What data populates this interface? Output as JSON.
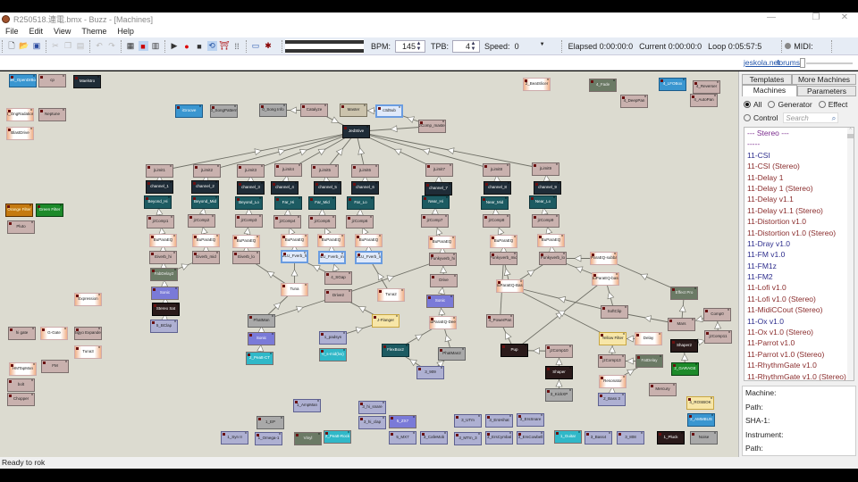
{
  "window": {
    "title": "R250518.連電.bmx - Buzz - [Machines]",
    "minimize": "—",
    "restore": "❐",
    "close": "✕"
  },
  "menu": [
    "File",
    "Edit",
    "View",
    "Theme",
    "Help"
  ],
  "toolbar": {
    "bpm_label": "BPM:",
    "bpm_value": "145",
    "tpb_label": "TPB:",
    "tpb_value": "4",
    "speed_label": "Speed:",
    "speed_value": "0",
    "elapsed": "Elapsed 0:00:00:0",
    "current": "Current 0:00:00:0",
    "loop": "Loop 0:05:57:5",
    "midi_label": "MIDI:"
  },
  "links": {
    "site": "jeskola.net",
    "forums": "forums"
  },
  "machines": [
    {
      "id": "sell",
      "name": "Sell_OpenDrBox"
    },
    {
      "id": "cp",
      "name": "cp"
    },
    {
      "id": "mael",
      "name": "Maelstro"
    },
    {
      "id": "ong",
      "name": "4_OngRadation"
    },
    {
      "id": "nep",
      "name": "Neptune"
    },
    {
      "id": "blast",
      "name": "BlastDrive"
    },
    {
      "id": "igr",
      "name": "iGroove"
    },
    {
      "id": "spat",
      "name": "0_SongPattern"
    },
    {
      "id": "sinfo",
      "name": "0_Song Info"
    },
    {
      "id": "cat",
      "name": "Catalyze"
    },
    {
      "id": "master",
      "name": "Master"
    },
    {
      "id": "sub",
      "name": "c3d5ub"
    },
    {
      "id": "jed",
      "name": "JedStive"
    },
    {
      "id": "jzm",
      "name": "jzComp_master"
    },
    {
      "id": "jl1",
      "name": "jLimit1"
    },
    {
      "id": "jl2",
      "name": "jLimit2"
    },
    {
      "id": "jl3",
      "name": "jLimit3"
    },
    {
      "id": "jl4",
      "name": "jLimit4"
    },
    {
      "id": "jl5",
      "name": "jLimit5"
    },
    {
      "id": "jl6",
      "name": "jLimit6"
    },
    {
      "id": "jl7",
      "name": "jLimit7"
    },
    {
      "id": "jl8",
      "name": "jLimit8"
    },
    {
      "id": "jl9",
      "name": "jLimit9"
    },
    {
      "id": "ch1",
      "name": "channel_1"
    },
    {
      "id": "ch2",
      "name": "channel_2"
    },
    {
      "id": "ch3",
      "name": "channel_3"
    },
    {
      "id": "ch4",
      "name": "channel_4"
    },
    {
      "id": "ch5",
      "name": "channel_5"
    },
    {
      "id": "ch6",
      "name": "channel_6"
    },
    {
      "id": "ch7",
      "name": "channel_7"
    },
    {
      "id": "ch8",
      "name": "channel_8"
    },
    {
      "id": "ch9",
      "name": "channel_9"
    },
    {
      "id": "bh",
      "name": "Beyond_Hi"
    },
    {
      "id": "bm",
      "name": "Beyond_Mid"
    },
    {
      "id": "bl",
      "name": "Beyond_Lo"
    },
    {
      "id": "fh",
      "name": "Far_Hi"
    },
    {
      "id": "fm",
      "name": "Far_Mid"
    },
    {
      "id": "fl",
      "name": "Far_Lo"
    },
    {
      "id": "nh",
      "name": "Near_Hi"
    },
    {
      "id": "nm",
      "name": "Near_Mid"
    },
    {
      "id": "nl",
      "name": "Near_Lo"
    },
    {
      "id": "jc1",
      "name": "jzComp1"
    },
    {
      "id": "jc2",
      "name": "jzComp2"
    },
    {
      "id": "jc3",
      "name": "jzComp3"
    },
    {
      "id": "jc4",
      "name": "jzComp4"
    },
    {
      "id": "jc5",
      "name": "jzComp5"
    },
    {
      "id": "jc6",
      "name": "jzComp6"
    },
    {
      "id": "jc7",
      "name": "jzComp7"
    },
    {
      "id": "jc8",
      "name": "jzComp8"
    },
    {
      "id": "jc9",
      "name": "jzComp9"
    },
    {
      "id": "eq1",
      "name": "BuParaEQ"
    },
    {
      "id": "eq2",
      "name": "BuParaEQ"
    },
    {
      "id": "eq3",
      "name": "BuParaEQ"
    },
    {
      "id": "eq4",
      "name": "BuParaEQ"
    },
    {
      "id": "eq5",
      "name": "BuParaEQ"
    },
    {
      "id": "eq6",
      "name": "BuParaEQ"
    },
    {
      "id": "eq7",
      "name": "BuParaEQ"
    },
    {
      "id": "eq8",
      "name": "BuParaEQ"
    },
    {
      "id": "eq9",
      "name": "BuParaEQ"
    },
    {
      "id": "evh",
      "name": "Eiverb_hi"
    },
    {
      "id": "evm",
      "name": "Eiverb_mid"
    },
    {
      "id": "evl",
      "name": "Eiverb_lo"
    },
    {
      "id": "mh",
      "name": "MLU_Fverb_hi"
    },
    {
      "id": "mm",
      "name": "MLU_Fverb_mid"
    },
    {
      "id": "ml",
      "name": "MLU_Fverb_lo"
    },
    {
      "id": "fkh",
      "name": "Funkyverb_hi"
    },
    {
      "id": "fkm",
      "name": "Funkyverb_mid"
    },
    {
      "id": "fkl",
      "name": "Funkyverb_lo"
    },
    {
      "id": "eqsb",
      "name": "BuParaEQ-subbass"
    },
    {
      "id": "fab",
      "name": "FabDelay2"
    },
    {
      "id": "son1",
      "name": "Sonic"
    },
    {
      "id": "ssat",
      "name": "Stereo Sat"
    },
    {
      "id": "bclap",
      "name": "5_BClap"
    },
    {
      "id": "expr",
      "name": "Expression"
    },
    {
      "id": "hig",
      "name": "hi gate"
    },
    {
      "id": "gg",
      "name": "G-Gate"
    },
    {
      "id": "bigyo",
      "name": "Bigyo Expander"
    },
    {
      "id": "tuna3",
      "name": "Tuna3"
    },
    {
      "id": "hmt",
      "name": "HMTapMan"
    },
    {
      "id": "fmm",
      "name": "FM"
    },
    {
      "id": "bolt",
      "name": "bolt"
    },
    {
      "id": "chop",
      "name": "Chopper"
    },
    {
      "id": "orf",
      "name": "Orange Filter"
    },
    {
      "id": "grf",
      "name": "Green Filter"
    },
    {
      "id": "pluto",
      "name": "Pluto"
    },
    {
      "id": "sgap",
      "name": "4_SGap"
    },
    {
      "id": "tuna",
      "name": "Tuna"
    },
    {
      "id": "drive2",
      "name": "Drive2"
    },
    {
      "id": "tuna2",
      "name": "Tuna2"
    },
    {
      "id": "drive",
      "name": "Drive"
    },
    {
      "id": "son3",
      "name": "Sonic"
    },
    {
      "id": "eqdeep",
      "name": "BuParaEQ-Deep"
    },
    {
      "id": "phat",
      "name": "PhatMan"
    },
    {
      "id": "son2",
      "name": "Sonic"
    },
    {
      "id": "peatt",
      "name": "2_Peatt-CT"
    },
    {
      "id": "jfl",
      "name": "J-Flanger"
    },
    {
      "id": "pad",
      "name": "1_padsyn"
    },
    {
      "id": "smid",
      "name": "0_s-mid(lvx)"
    },
    {
      "id": "flex",
      "name": "FlexBox2"
    },
    {
      "id": "phat2",
      "name": "PhatMan2"
    },
    {
      "id": "909",
      "name": "3_909"
    },
    {
      "id": "bs",
      "name": "2_BeatSlicer"
    },
    {
      "id": "fade",
      "name": "4_Fade"
    },
    {
      "id": "dpan",
      "name": "4_DeepPan"
    },
    {
      "id": "lfo",
      "name": "4_LFOBox"
    },
    {
      "id": "rev",
      "name": "4_Reverser"
    },
    {
      "id": "apan",
      "name": "4_AutoPan"
    },
    {
      "id": "eqb",
      "name": "BuParaEQ-Bass"
    },
    {
      "id": "eqb2",
      "name": "BuParaEQ-bass"
    },
    {
      "id": "soft",
      "name": "SoftClip"
    },
    {
      "id": "efx",
      "name": "Effect Pro"
    },
    {
      "id": "mars",
      "name": "Mars"
    },
    {
      "id": "comp0",
      "name": "Comp0"
    },
    {
      "id": "jc11",
      "name": "jzComp11"
    },
    {
      "id": "ppan",
      "name": "4_PowerPan"
    },
    {
      "id": "dog",
      "name": "Pup"
    },
    {
      "id": "jc10",
      "name": "jzComp10"
    },
    {
      "id": "shaper",
      "name": "Shaper"
    },
    {
      "id": "kick",
      "name": "3_KickXP"
    },
    {
      "id": "yf",
      "name": "Yellow Filter"
    },
    {
      "id": "delay",
      "name": "Delay"
    },
    {
      "id": "jc13",
      "name": "jzComp13"
    },
    {
      "id": "fatd",
      "name": "FatDelay"
    },
    {
      "id": "reso",
      "name": "Resonator"
    },
    {
      "id": "bass3",
      "name": "2_Bass 3"
    },
    {
      "id": "shaper2",
      "name": "Shaper2"
    },
    {
      "id": "garage",
      "name": "2_GARAGE"
    },
    {
      "id": "merc",
      "name": "Mercury"
    },
    {
      "id": "rosbok",
      "name": "4_ROSBOK"
    },
    {
      "id": "amm",
      "name": "2_AMMBUS"
    },
    {
      "id": "amp",
      "name": "1_AmpMan"
    },
    {
      "id": "hsn",
      "name": "3_hi_snare"
    },
    {
      "id": "hcl",
      "name": "3_hi_clap"
    },
    {
      "id": "zx7",
      "name": "5_ZX7"
    },
    {
      "id": "ep",
      "name": "1_EP"
    },
    {
      "id": "syn2",
      "name": "1_Syn II"
    },
    {
      "id": "omega",
      "name": "1_Omega-1"
    },
    {
      "id": "vinyl",
      "name": "Vinyl"
    },
    {
      "id": "prock",
      "name": "2_Peatt-Rock"
    },
    {
      "id": "mx7",
      "name": "5_MX7"
    },
    {
      "id": "cafe",
      "name": "3_CafeMob"
    },
    {
      "id": "utm",
      "name": "3_UTm"
    },
    {
      "id": "mtm",
      "name": "3_MTm_3"
    },
    {
      "id": "ehh",
      "name": "3_ErsHihat"
    },
    {
      "id": "esn",
      "name": "3_ErsSnare"
    },
    {
      "id": "ecy",
      "name": "3_ErsCymbal"
    },
    {
      "id": "ecb",
      "name": "3_ErsCowbell"
    },
    {
      "id": "guit",
      "name": "1_Guitar"
    },
    {
      "id": "bass4",
      "name": "3_Bass4"
    },
    {
      "id": "808",
      "name": "3_808"
    },
    {
      "id": "pluck",
      "name": "1_Pluck"
    },
    {
      "id": "noise",
      "name": "Noise"
    }
  ],
  "connections": [
    [
      "jl1",
      "jed"
    ],
    [
      "jl2",
      "jed"
    ],
    [
      "jl3",
      "jed"
    ],
    [
      "jl4",
      "jed"
    ],
    [
      "jl5",
      "jed"
    ],
    [
      "jl6",
      "jed"
    ],
    [
      "jl7",
      "jed"
    ],
    [
      "jl8",
      "jed"
    ],
    [
      "jl9",
      "jed"
    ],
    [
      "cat",
      "sinfo"
    ],
    [
      "cat",
      "jed"
    ],
    [
      "sub",
      "master"
    ],
    [
      "jzm",
      "jed"
    ],
    [
      "jzm",
      "sub"
    ],
    [
      "ch1",
      "jl1"
    ],
    [
      "ch2",
      "jl2"
    ],
    [
      "ch3",
      "jl3"
    ],
    [
      "ch4",
      "jl4"
    ],
    [
      "ch5",
      "jl5"
    ],
    [
      "ch6",
      "jl6"
    ],
    [
      "ch7",
      "jl7"
    ],
    [
      "ch8",
      "jl8"
    ],
    [
      "ch9",
      "jl9"
    ],
    [
      "jc1",
      "bh"
    ],
    [
      "jc2",
      "bm"
    ],
    [
      "jc3",
      "bl"
    ],
    [
      "jc4",
      "fh"
    ],
    [
      "jc5",
      "fm"
    ],
    [
      "jc6",
      "fl"
    ],
    [
      "jc7",
      "nh"
    ],
    [
      "jc8",
      "nm"
    ],
    [
      "jc9",
      "nl"
    ],
    [
      "eq1",
      "jc1"
    ],
    [
      "eq2",
      "jc2"
    ],
    [
      "eq3",
      "jc3"
    ],
    [
      "eq4",
      "jc4"
    ],
    [
      "eq5",
      "jc5"
    ],
    [
      "eq6",
      "jc6"
    ],
    [
      "eq7",
      "jc7"
    ],
    [
      "eq8",
      "jc8"
    ],
    [
      "eq9",
      "jc9"
    ],
    [
      "evh",
      "eq1"
    ],
    [
      "evm",
      "eq2"
    ],
    [
      "evl",
      "eq3"
    ],
    [
      "mh",
      "eq4"
    ],
    [
      "mm",
      "eq5"
    ],
    [
      "ml",
      "eq6"
    ],
    [
      "fkh",
      "eq7"
    ],
    [
      "fkm",
      "eq8"
    ],
    [
      "fkl",
      "eq9"
    ],
    [
      "fab",
      "evh"
    ],
    [
      "fab",
      "evm"
    ],
    [
      "son1",
      "fab"
    ],
    [
      "ssat",
      "son1"
    ],
    [
      "bclap",
      "ssat"
    ],
    [
      "tuna",
      "evl"
    ],
    [
      "tuna",
      "mh"
    ],
    [
      "sgap",
      "mh"
    ],
    [
      "sgap",
      "mm"
    ],
    [
      "tuna2",
      "ml"
    ],
    [
      "drive2",
      "fkh"
    ],
    [
      "drive",
      "fkh"
    ],
    [
      "son3",
      "drive"
    ],
    [
      "eqdeep",
      "son3"
    ],
    [
      "phat",
      "tuna"
    ],
    [
      "phat",
      "drive2"
    ],
    [
      "son2",
      "phat"
    ],
    [
      "peatt",
      "son2"
    ],
    [
      "jfl",
      "drive2"
    ],
    [
      "pad",
      "jfl"
    ],
    [
      "flex",
      "eqdeep"
    ],
    [
      "909",
      "flex"
    ],
    [
      "909",
      "phat2"
    ],
    [
      "phat2",
      "eqdeep"
    ],
    [
      "eqb",
      "fkm"
    ],
    [
      "eqb",
      "fkl"
    ],
    [
      "eqsb",
      "fkl"
    ],
    [
      "eqb2",
      "fkl"
    ],
    [
      "soft",
      "eqb2"
    ],
    [
      "soft",
      "eqb"
    ],
    [
      "ppan",
      "fkm"
    ],
    [
      "dog",
      "ppan"
    ],
    [
      "dog",
      "eqb2"
    ],
    [
      "jc10",
      "dog"
    ],
    [
      "shaper",
      "jc10"
    ],
    [
      "kick",
      "shaper"
    ],
    [
      "yf",
      "eqb"
    ],
    [
      "delay",
      "yf"
    ],
    [
      "jc13",
      "yf"
    ],
    [
      "fatd",
      "jc13"
    ],
    [
      "reso",
      "fatd"
    ],
    [
      "bass3",
      "reso"
    ],
    [
      "mars",
      "soft"
    ],
    [
      "mars",
      "efx"
    ],
    [
      "efx",
      "eqsb"
    ],
    [
      "comp0",
      "mars"
    ],
    [
      "jc11",
      "comp0"
    ],
    [
      "shaper2",
      "jc11"
    ],
    [
      "garage",
      "shaper2"
    ]
  ],
  "panel": {
    "tabs_top": [
      "Templates",
      "More Machines"
    ],
    "tabs_bottom": [
      "Machines",
      "Parameters"
    ],
    "filters": {
      "all": "All",
      "generator": "Generator",
      "effect": "Effect",
      "control": "Control",
      "selected": "All"
    },
    "search_placeholder": "Search",
    "list": [
      {
        "label": "--- Stereo ---",
        "kind": "header"
      },
      {
        "label": "-----",
        "kind": "header"
      },
      {
        "label": "11-CSI",
        "kind": "gen"
      },
      {
        "label": "11-CSI (Stereo)",
        "kind": "fx"
      },
      {
        "label": "11-Delay 1",
        "kind": "fx"
      },
      {
        "label": "11-Delay 1 (Stereo)",
        "kind": "fx"
      },
      {
        "label": "11-Delay v1.1",
        "kind": "fx"
      },
      {
        "label": "11-Delay v1.1 (Stereo)",
        "kind": "fx"
      },
      {
        "label": "11-Distortion v1.0",
        "kind": "fx"
      },
      {
        "label": "11-Distortion v1.0 (Stereo)",
        "kind": "fx"
      },
      {
        "label": "11-Dray v1.0",
        "kind": "gen"
      },
      {
        "label": "11-FM v1.0",
        "kind": "gen"
      },
      {
        "label": "11-FM1z",
        "kind": "gen"
      },
      {
        "label": "11-FM2",
        "kind": "gen"
      },
      {
        "label": "11-Lofi v1.0",
        "kind": "fx"
      },
      {
        "label": "11-Lofi v1.0 (Stereo)",
        "kind": "fx"
      },
      {
        "label": "11-MidiCCout (Stereo)",
        "kind": "fx"
      },
      {
        "label": "11-Ox v1.0",
        "kind": "gen"
      },
      {
        "label": "11-Ox v1.0 (Stereo)",
        "kind": "fx"
      },
      {
        "label": "11-Parrot v1.0",
        "kind": "fx"
      },
      {
        "label": "11-Parrot v1.0 (Stereo)",
        "kind": "fx"
      },
      {
        "label": "11-RhythmGate v1.0",
        "kind": "fx"
      },
      {
        "label": "11-RhythmGate v1.0 (Stereo)",
        "kind": "fx"
      }
    ],
    "info": [
      "Machine:",
      "Path:",
      "SHA-1:",
      "Instrument:",
      "Path:"
    ]
  },
  "colors": {
    "header": "#7b2d8e",
    "gen": "#2c2c8c",
    "fx": "#8a2c2c",
    "canvas": "#dcdbd0"
  },
  "status": "Ready to rok"
}
